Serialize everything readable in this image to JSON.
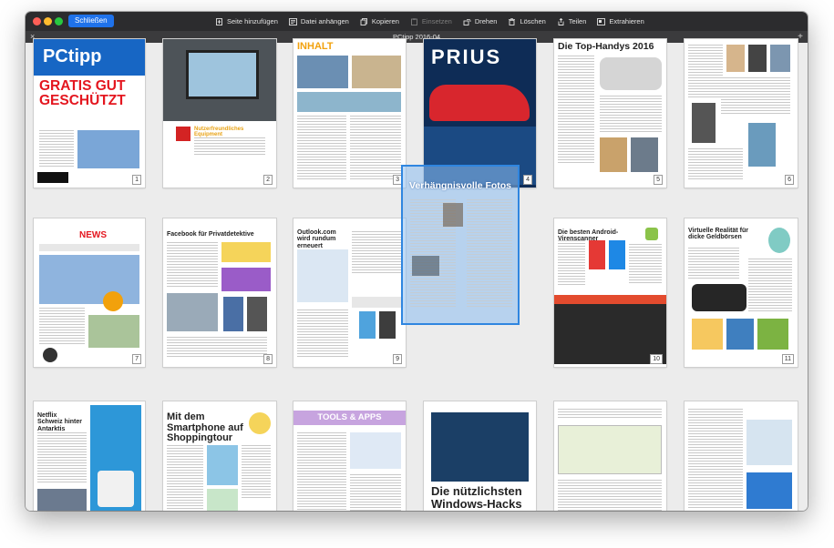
{
  "toolbar": {
    "close_label": "Schließen",
    "actions": [
      {
        "label": "Seite hinzufügen",
        "icon": "add-page-icon",
        "enabled": true
      },
      {
        "label": "Datei anhängen",
        "icon": "attach-file-icon",
        "enabled": true
      },
      {
        "label": "Kopieren",
        "icon": "copy-icon",
        "enabled": true
      },
      {
        "label": "Einsetzen",
        "icon": "paste-icon",
        "enabled": false
      },
      {
        "label": "Drehen",
        "icon": "rotate-icon",
        "enabled": true
      },
      {
        "label": "Löschen",
        "icon": "trash-icon",
        "enabled": true
      },
      {
        "label": "Teilen",
        "icon": "share-icon",
        "enabled": true
      },
      {
        "label": "Extrahieren",
        "icon": "extract-icon",
        "enabled": true
      }
    ]
  },
  "document": {
    "title": "PCtipp 2016-04",
    "tab_close": "×",
    "tab_add": "+"
  },
  "pages": [
    {
      "number": "1",
      "heading": "GRATIS GUT GESCHÜTZT"
    },
    {
      "number": "2",
      "heading": "Nutzerfreundliches Equipment"
    },
    {
      "number": "3",
      "heading": "INHALT"
    },
    {
      "number": "4",
      "heading": "PRIUS"
    },
    {
      "number": "5",
      "heading": "Die Top-Handys 2016"
    },
    {
      "number": "6",
      "heading": ""
    },
    {
      "number": "7",
      "heading": "NEWS"
    },
    {
      "number": "8",
      "heading": "Facebook für Privatdetektive"
    },
    {
      "number": "9",
      "heading": "Outlook.com wird rundum erneuert"
    },
    {
      "number": "10",
      "heading": "Die besten Android-Virenscanner"
    },
    {
      "number": "11",
      "heading": "Virtuelle Realität für dicke Geldbörsen"
    },
    {
      "number": "",
      "heading": "Netflix Schweiz hinter Antarktis"
    },
    {
      "number": "",
      "heading": "Mit dem Smartphone auf Shoppingtour"
    },
    {
      "number": "",
      "heading": "TOOLS & APPS"
    },
    {
      "number": "",
      "heading": "Die nützlichsten Windows-Hacks"
    },
    {
      "number": "",
      "heading": ""
    },
    {
      "number": "",
      "heading": ""
    }
  ],
  "dragged_page": {
    "heading": "Verhängnisvolle Fotos"
  },
  "colors": {
    "accent": "#1f72ea",
    "toolbar_bg": "#2c2c2e",
    "drag_border": "#2f86e0"
  }
}
